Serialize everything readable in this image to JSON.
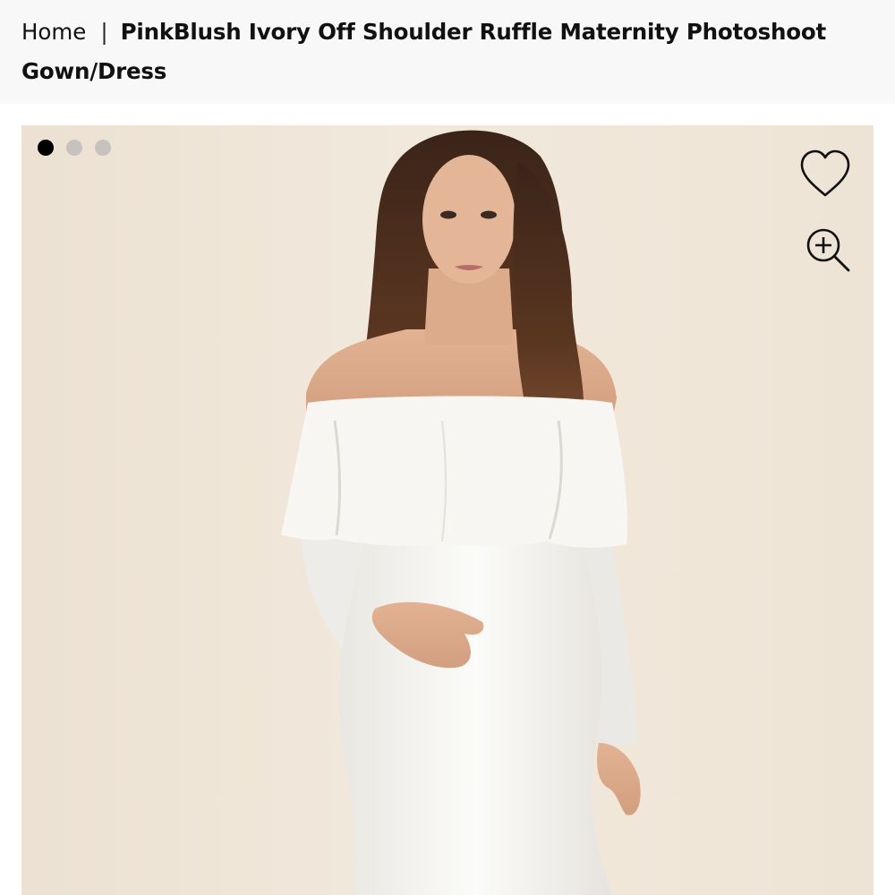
{
  "breadcrumb": {
    "home_label": "Home",
    "separator": "|",
    "current_label": "PinkBlush Ivory Off Shoulder Ruffle Maternity Photoshoot Gown/Dress"
  },
  "gallery": {
    "image_count": 3,
    "active_index": 1
  },
  "icons": {
    "wishlist": "heart-icon",
    "zoom": "zoom-in-icon"
  },
  "colors": {
    "header_bg": "#f8f8f8",
    "backdrop": "#efe6d8",
    "dot_active": "#000000",
    "dot_inactive": "#c7c2bd"
  }
}
